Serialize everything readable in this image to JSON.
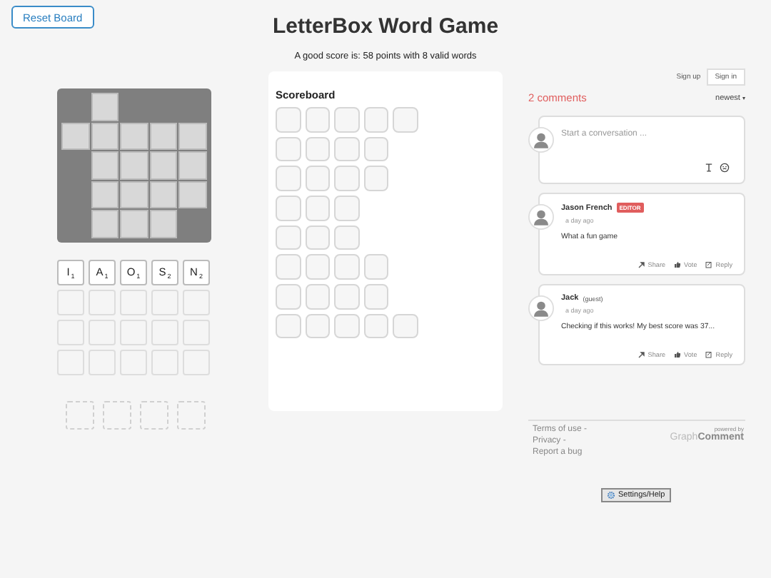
{
  "reset_button": "Reset Board",
  "title": "LetterBox Word Game",
  "subtitle": "A good score is: 58 points with 8 valid words",
  "board": {
    "rows": [
      {
        "cells": [
          false,
          true,
          false,
          false,
          false
        ]
      },
      {
        "cells": [
          true,
          true,
          true,
          true,
          true
        ]
      },
      {
        "cells": [
          false,
          true,
          true,
          true,
          true
        ]
      },
      {
        "cells": [
          false,
          true,
          true,
          true,
          true
        ]
      },
      {
        "cells": [
          false,
          true,
          true,
          true,
          false
        ]
      }
    ]
  },
  "tile_rows": [
    [
      {
        "kind": "letter",
        "letter": "I",
        "score": "1"
      },
      {
        "kind": "letter",
        "letter": "A",
        "score": "1"
      },
      {
        "kind": "letter",
        "letter": "O",
        "score": "1"
      },
      {
        "kind": "letter",
        "letter": "S",
        "score": "2"
      },
      {
        "kind": "letter",
        "letter": "N",
        "score": "2"
      }
    ],
    [
      {
        "kind": "empty"
      },
      {
        "kind": "empty"
      },
      {
        "kind": "empty"
      },
      {
        "kind": "empty"
      },
      {
        "kind": "empty"
      }
    ],
    [
      {
        "kind": "empty"
      },
      {
        "kind": "empty"
      },
      {
        "kind": "empty"
      },
      {
        "kind": "empty"
      },
      {
        "kind": "empty"
      }
    ],
    [
      {
        "kind": "empty"
      },
      {
        "kind": "empty"
      },
      {
        "kind": "empty"
      },
      {
        "kind": "empty"
      },
      {
        "kind": "empty"
      }
    ]
  ],
  "bonus_slots": [
    {
      "kind": "dashed"
    },
    {
      "kind": "dashed"
    },
    {
      "kind": "dashed"
    },
    {
      "kind": "dashed"
    }
  ],
  "scoreboard": {
    "title": "Scoreboard",
    "rows": [
      {
        "boxes": [
          false,
          false,
          false,
          false,
          false
        ]
      },
      {
        "boxes": [
          false,
          false,
          false,
          false
        ]
      },
      {
        "boxes": [
          false,
          false,
          false,
          false
        ]
      },
      {
        "boxes": [
          false,
          false,
          false
        ]
      },
      {
        "boxes": [
          false,
          false,
          false
        ]
      },
      {
        "boxes": [
          false,
          false,
          false,
          false
        ]
      },
      {
        "boxes": [
          false,
          false,
          false,
          false
        ]
      },
      {
        "boxes": [
          false,
          false,
          false,
          false,
          false
        ]
      }
    ]
  },
  "comments": {
    "sign_up": "Sign up",
    "sign_in": "Sign in",
    "count": "2 comments",
    "sort": "newest",
    "sort_caret": "▾",
    "composer_placeholder": "Start a conversation ...",
    "items": [
      {
        "author": "Jason French",
        "badge": "EDITOR",
        "time": "a day ago",
        "text": "What a fun game",
        "actions": [
          "Share",
          "Vote",
          "Reply"
        ]
      },
      {
        "author": "Jack",
        "role": "(guest)",
        "time": "a day ago",
        "text": "Checking if this works! My best score was 37...",
        "actions": [
          "Share",
          "Vote",
          "Reply"
        ]
      }
    ],
    "footer_links": [
      "Terms of use -",
      "Privacy -",
      "Report a bug"
    ],
    "powered_by": "powered by",
    "brand_light": "Graph",
    "brand_bold": "Comment"
  },
  "settings_button": "Settings/Help"
}
